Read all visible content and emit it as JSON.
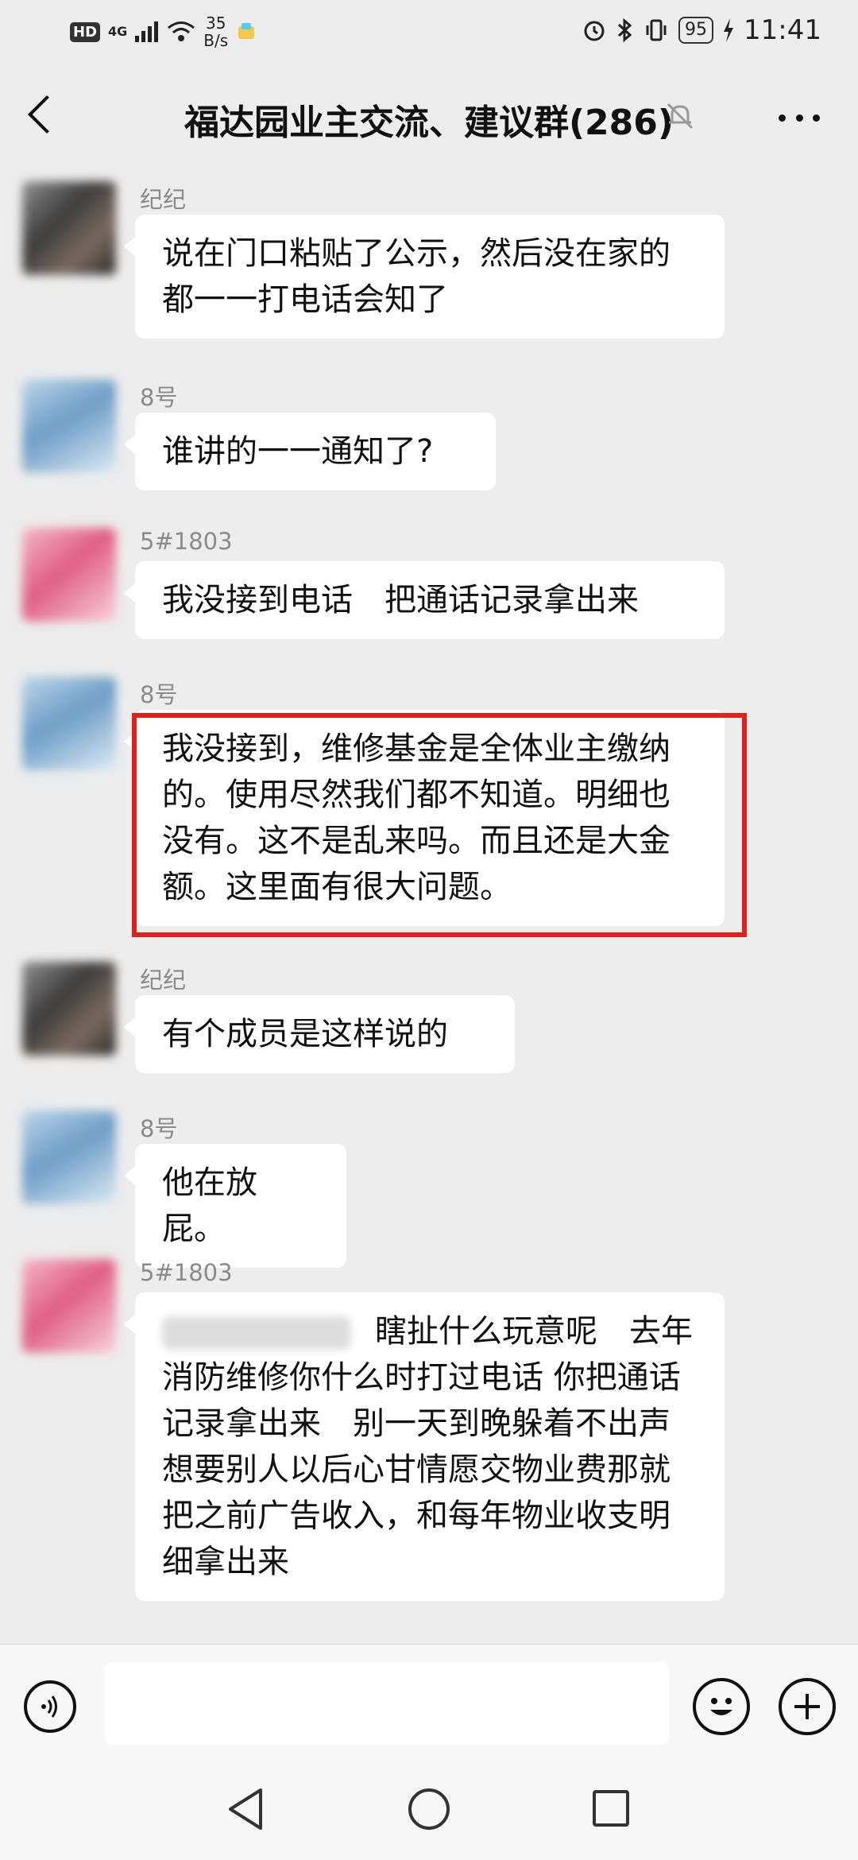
{
  "status_bar": {
    "hd": "HD",
    "network": "4G",
    "speed_value": "35",
    "speed_unit": "B/s",
    "battery": "95",
    "time": "11:41"
  },
  "header": {
    "title": "福达园业主交流、建议群(286)"
  },
  "messages": [
    {
      "sender": "纪纪",
      "text": "说在门口粘贴了公示，然后没在家的都一一打电话会知了"
    },
    {
      "sender": "8号",
      "text": "谁讲的一一通知了?"
    },
    {
      "sender": "5#1803",
      "text": "我没接到电话　把通话记录拿出来"
    },
    {
      "sender": "8号",
      "text": "我没接到，维修基金是全体业主缴纳的。使用尽然我们都不知道。明细也没有。这不是乱来吗。而且还是大金额。这里面有很大问题。"
    },
    {
      "sender": "纪纪",
      "text": "有个成员是这样说的"
    },
    {
      "sender": "8号",
      "text": "他在放屁。"
    },
    {
      "sender": "5#1803",
      "text": "瞎扯什么玩意呢　去年消防维修你什么时打过电话 你把通话记录拿出来　别一天到晚躲着不出声 想要别人以后心甘情愿交物业费那就把之前广告收入，和每年物业收支明细拿出来"
    }
  ],
  "colors": {
    "background": "#ededed",
    "bubble": "#ffffff",
    "highlight_border": "#e0201c"
  },
  "icons": [
    "back-arrow-icon",
    "mute-bell-icon",
    "more-icon",
    "voice-icon",
    "emoji-icon",
    "plus-icon",
    "nav-back-icon",
    "nav-home-icon",
    "nav-recent-icon"
  ]
}
